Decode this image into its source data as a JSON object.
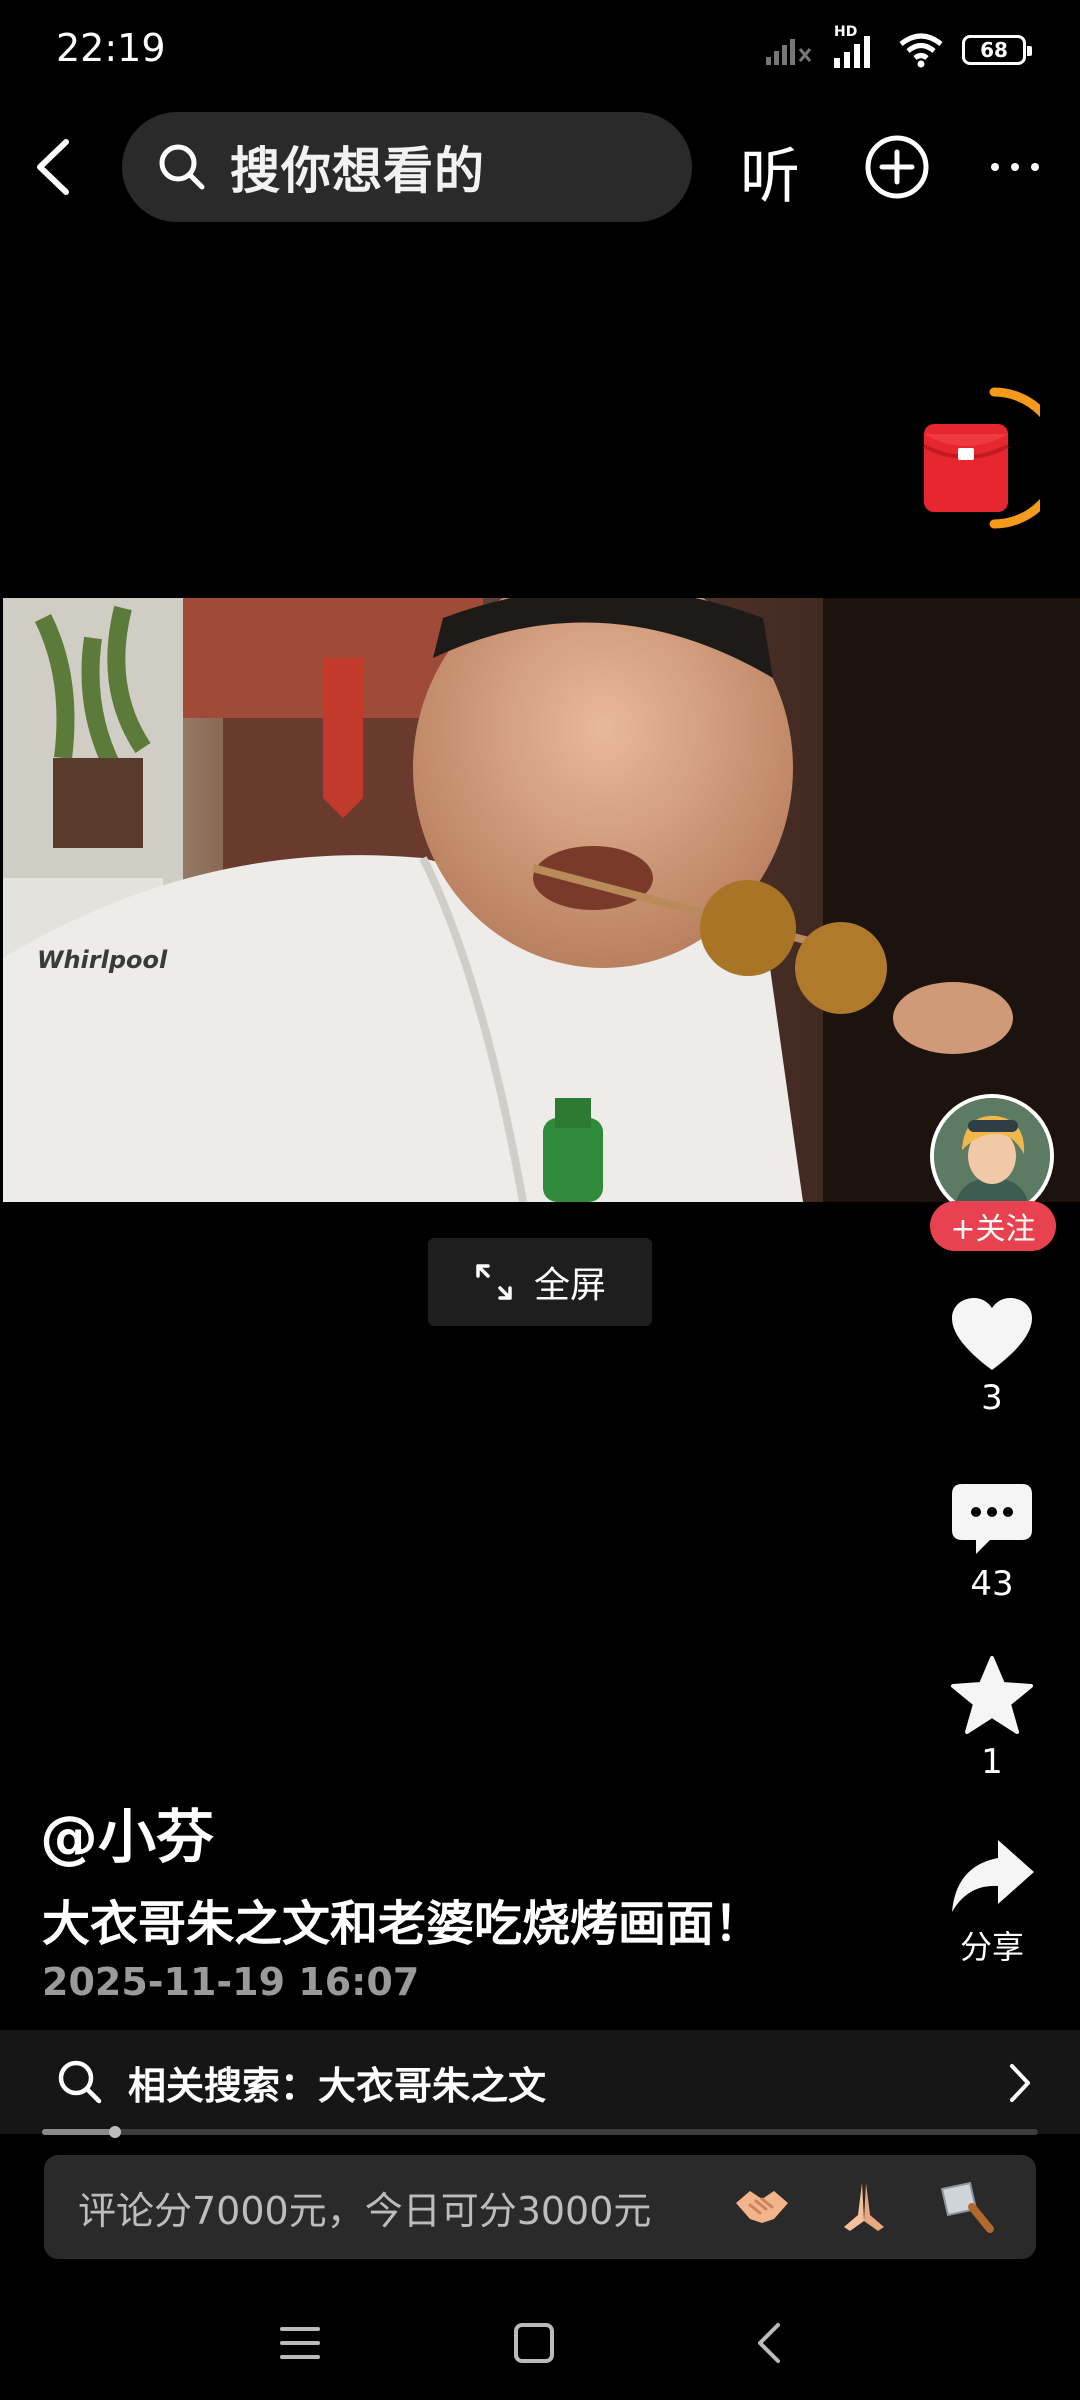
{
  "status_bar": {
    "time": "22:19",
    "network_label": "HD",
    "battery_level": "68"
  },
  "top_bar": {
    "search_placeholder": "搜你想看的",
    "listen_label": "听"
  },
  "video_player": {
    "fullscreen_label": "全屏",
    "playback_progress": 0.073
  },
  "side_actions": {
    "follow_label": "+关注",
    "like_count": "3",
    "comment_count": "43",
    "favorite_count": "1",
    "share_label": "分享"
  },
  "post": {
    "username": "@小芬",
    "title": "大衣哥朱之文和老婆吃烧烤画面！",
    "timestamp": "2025-11-19 16:07"
  },
  "related_search": {
    "label": "相关搜索：大衣哥朱之文"
  },
  "comment_banner": {
    "text": "评论分7000元，今日可分3000元",
    "emojis": [
      "handshake-emoji",
      "praying-hands-emoji",
      "cleaver-knife-emoji"
    ]
  },
  "colors": {
    "accent_red": "#e8414f",
    "envelope_orange": "#f59a1b",
    "background": "#000000"
  }
}
